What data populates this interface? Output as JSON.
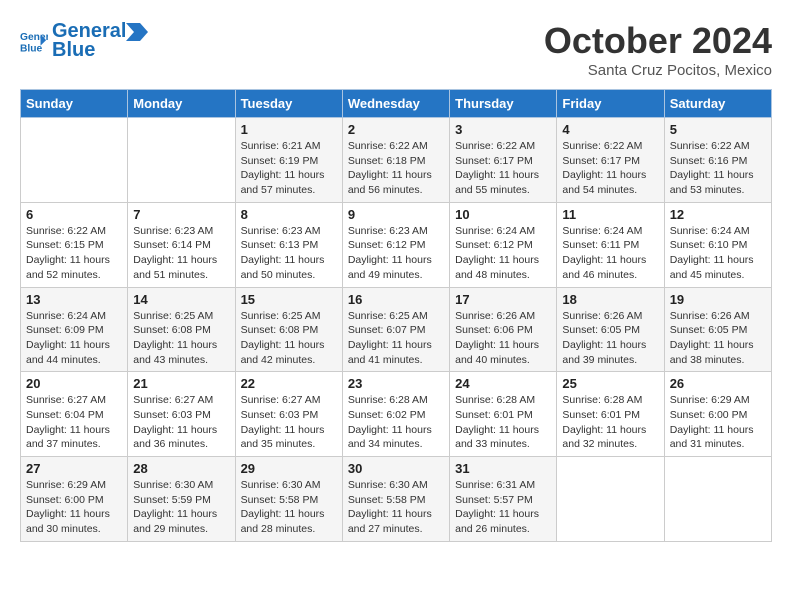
{
  "logo": {
    "line1": "General",
    "line2": "Blue"
  },
  "title": "October 2024",
  "subtitle": "Santa Cruz Pocitos, Mexico",
  "days_of_week": [
    "Sunday",
    "Monday",
    "Tuesday",
    "Wednesday",
    "Thursday",
    "Friday",
    "Saturday"
  ],
  "weeks": [
    [
      {
        "day": "",
        "info": ""
      },
      {
        "day": "",
        "info": ""
      },
      {
        "day": "1",
        "info": "Sunrise: 6:21 AM\nSunset: 6:19 PM\nDaylight: 11 hours and 57 minutes."
      },
      {
        "day": "2",
        "info": "Sunrise: 6:22 AM\nSunset: 6:18 PM\nDaylight: 11 hours and 56 minutes."
      },
      {
        "day": "3",
        "info": "Sunrise: 6:22 AM\nSunset: 6:17 PM\nDaylight: 11 hours and 55 minutes."
      },
      {
        "day": "4",
        "info": "Sunrise: 6:22 AM\nSunset: 6:17 PM\nDaylight: 11 hours and 54 minutes."
      },
      {
        "day": "5",
        "info": "Sunrise: 6:22 AM\nSunset: 6:16 PM\nDaylight: 11 hours and 53 minutes."
      }
    ],
    [
      {
        "day": "6",
        "info": "Sunrise: 6:22 AM\nSunset: 6:15 PM\nDaylight: 11 hours and 52 minutes."
      },
      {
        "day": "7",
        "info": "Sunrise: 6:23 AM\nSunset: 6:14 PM\nDaylight: 11 hours and 51 minutes."
      },
      {
        "day": "8",
        "info": "Sunrise: 6:23 AM\nSunset: 6:13 PM\nDaylight: 11 hours and 50 minutes."
      },
      {
        "day": "9",
        "info": "Sunrise: 6:23 AM\nSunset: 6:12 PM\nDaylight: 11 hours and 49 minutes."
      },
      {
        "day": "10",
        "info": "Sunrise: 6:24 AM\nSunset: 6:12 PM\nDaylight: 11 hours and 48 minutes."
      },
      {
        "day": "11",
        "info": "Sunrise: 6:24 AM\nSunset: 6:11 PM\nDaylight: 11 hours and 46 minutes."
      },
      {
        "day": "12",
        "info": "Sunrise: 6:24 AM\nSunset: 6:10 PM\nDaylight: 11 hours and 45 minutes."
      }
    ],
    [
      {
        "day": "13",
        "info": "Sunrise: 6:24 AM\nSunset: 6:09 PM\nDaylight: 11 hours and 44 minutes."
      },
      {
        "day": "14",
        "info": "Sunrise: 6:25 AM\nSunset: 6:08 PM\nDaylight: 11 hours and 43 minutes."
      },
      {
        "day": "15",
        "info": "Sunrise: 6:25 AM\nSunset: 6:08 PM\nDaylight: 11 hours and 42 minutes."
      },
      {
        "day": "16",
        "info": "Sunrise: 6:25 AM\nSunset: 6:07 PM\nDaylight: 11 hours and 41 minutes."
      },
      {
        "day": "17",
        "info": "Sunrise: 6:26 AM\nSunset: 6:06 PM\nDaylight: 11 hours and 40 minutes."
      },
      {
        "day": "18",
        "info": "Sunrise: 6:26 AM\nSunset: 6:05 PM\nDaylight: 11 hours and 39 minutes."
      },
      {
        "day": "19",
        "info": "Sunrise: 6:26 AM\nSunset: 6:05 PM\nDaylight: 11 hours and 38 minutes."
      }
    ],
    [
      {
        "day": "20",
        "info": "Sunrise: 6:27 AM\nSunset: 6:04 PM\nDaylight: 11 hours and 37 minutes."
      },
      {
        "day": "21",
        "info": "Sunrise: 6:27 AM\nSunset: 6:03 PM\nDaylight: 11 hours and 36 minutes."
      },
      {
        "day": "22",
        "info": "Sunrise: 6:27 AM\nSunset: 6:03 PM\nDaylight: 11 hours and 35 minutes."
      },
      {
        "day": "23",
        "info": "Sunrise: 6:28 AM\nSunset: 6:02 PM\nDaylight: 11 hours and 34 minutes."
      },
      {
        "day": "24",
        "info": "Sunrise: 6:28 AM\nSunset: 6:01 PM\nDaylight: 11 hours and 33 minutes."
      },
      {
        "day": "25",
        "info": "Sunrise: 6:28 AM\nSunset: 6:01 PM\nDaylight: 11 hours and 32 minutes."
      },
      {
        "day": "26",
        "info": "Sunrise: 6:29 AM\nSunset: 6:00 PM\nDaylight: 11 hours and 31 minutes."
      }
    ],
    [
      {
        "day": "27",
        "info": "Sunrise: 6:29 AM\nSunset: 6:00 PM\nDaylight: 11 hours and 30 minutes."
      },
      {
        "day": "28",
        "info": "Sunrise: 6:30 AM\nSunset: 5:59 PM\nDaylight: 11 hours and 29 minutes."
      },
      {
        "day": "29",
        "info": "Sunrise: 6:30 AM\nSunset: 5:58 PM\nDaylight: 11 hours and 28 minutes."
      },
      {
        "day": "30",
        "info": "Sunrise: 6:30 AM\nSunset: 5:58 PM\nDaylight: 11 hours and 27 minutes."
      },
      {
        "day": "31",
        "info": "Sunrise: 6:31 AM\nSunset: 5:57 PM\nDaylight: 11 hours and 26 minutes."
      },
      {
        "day": "",
        "info": ""
      },
      {
        "day": "",
        "info": ""
      }
    ]
  ]
}
